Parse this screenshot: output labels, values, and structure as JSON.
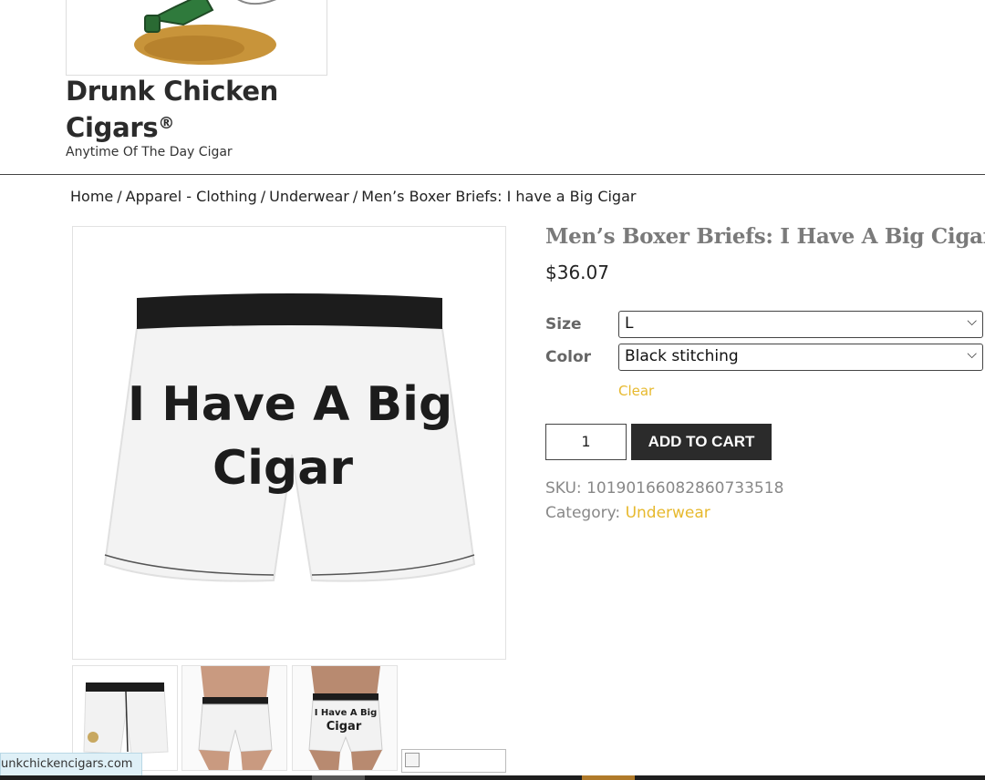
{
  "header": {
    "site_title_line1": "Drunk Chicken",
    "site_title_line2": "Cigars",
    "site_title_mark": "®",
    "tagline": "Anytime Of The Day Cigar"
  },
  "breadcrumb": {
    "home": "Home",
    "sep": "/",
    "cat1": "Apparel - Clothing",
    "cat2": "Underwear",
    "current": "Men’s Boxer Briefs: I have a Big Cigar"
  },
  "product": {
    "title": "Men’s Boxer Briefs: I Have A Big Cigar",
    "price": "$36.07",
    "image_text_line1": "I Have A Big",
    "image_text_line2": "Cigar",
    "thumb3_text_line1": "I Have A Big",
    "thumb3_text_line2": "Cigar",
    "size_label": "Size",
    "size_value": "L",
    "color_label": "Color",
    "color_value": "Black stitching",
    "clear_label": "Clear",
    "quantity": "1",
    "add_to_cart_label": "ADD TO CART",
    "sku_label": "SKU:",
    "sku_value": "10190166082860733518",
    "category_label": "Category:",
    "category_value": "Underwear"
  },
  "status_bar": {
    "url": "unkchickencigars.com"
  },
  "colors": {
    "accent": "#e7b92e",
    "button_bg": "#2b2b2b",
    "title_gray": "#7a7a7a"
  }
}
